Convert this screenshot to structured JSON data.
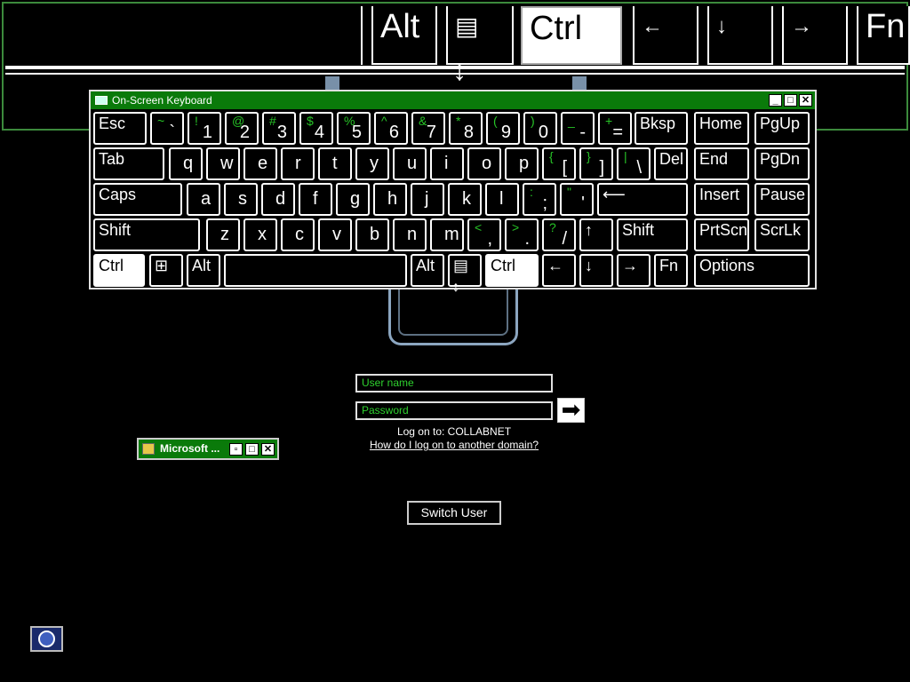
{
  "top_keys": [
    {
      "label": "Alt"
    },
    {
      "label": "▤"
    },
    {
      "label": "Ctrl"
    },
    {
      "label": "←"
    },
    {
      "label": "↓"
    },
    {
      "label": "→"
    },
    {
      "label": "Fn"
    }
  ],
  "osk": {
    "title": "On-Screen Keyboard",
    "buttons": {
      "minimize": "_",
      "maximize": "□",
      "close": "✕"
    },
    "rows": [
      [
        {
          "label": "Esc"
        },
        {
          "s": "~",
          "m": "`"
        },
        {
          "s": "!",
          "m": "1"
        },
        {
          "s": "@",
          "m": "2"
        },
        {
          "s": "#",
          "m": "3"
        },
        {
          "s": "$",
          "m": "4"
        },
        {
          "s": "%",
          "m": "5"
        },
        {
          "s": "^",
          "m": "6"
        },
        {
          "s": "&",
          "m": "7"
        },
        {
          "s": "*",
          "m": "8"
        },
        {
          "s": "(",
          "m": "9"
        },
        {
          "s": ")",
          "m": "0"
        },
        {
          "s": "_",
          "m": "-"
        },
        {
          "s": "+",
          "m": "="
        },
        {
          "label": "Bksp"
        },
        {
          "label": "Home"
        },
        {
          "label": "PgUp"
        }
      ],
      [
        {
          "label": "Tab"
        },
        {
          "label": "q"
        },
        {
          "label": "w"
        },
        {
          "label": "e"
        },
        {
          "label": "r"
        },
        {
          "label": "t"
        },
        {
          "label": "y"
        },
        {
          "label": "u"
        },
        {
          "label": "i"
        },
        {
          "label": "o"
        },
        {
          "label": "p"
        },
        {
          "s": "{",
          "m": "["
        },
        {
          "s": "}",
          "m": "]"
        },
        {
          "s": "|",
          "m": "\\"
        },
        {
          "label": "Del"
        },
        {
          "label": "End"
        },
        {
          "label": "PgDn"
        }
      ],
      [
        {
          "label": "Caps"
        },
        {
          "label": "a"
        },
        {
          "label": "s"
        },
        {
          "label": "d"
        },
        {
          "label": "f"
        },
        {
          "label": "g"
        },
        {
          "label": "h"
        },
        {
          "label": "j"
        },
        {
          "label": "k"
        },
        {
          "label": "l"
        },
        {
          "s": ":",
          "m": ";"
        },
        {
          "s": "\"",
          "m": "'"
        },
        {
          "label": "⟵"
        },
        {
          "label": "Insert"
        },
        {
          "label": "Pause"
        }
      ],
      [
        {
          "label": "Shift"
        },
        {
          "label": "z"
        },
        {
          "label": "x"
        },
        {
          "label": "c"
        },
        {
          "label": "v"
        },
        {
          "label": "b"
        },
        {
          "label": "n"
        },
        {
          "label": "m"
        },
        {
          "s": "<",
          "m": ","
        },
        {
          "s": ">",
          "m": "."
        },
        {
          "s": "?",
          "m": "/"
        },
        {
          "label": "↑"
        },
        {
          "label": "Shift"
        },
        {
          "label": "PrtScn"
        },
        {
          "label": "ScrLk"
        }
      ],
      [
        {
          "label": "Ctrl"
        },
        {
          "label": "⊞"
        },
        {
          "label": "Alt"
        },
        {
          "label": ""
        },
        {
          "label": "Alt"
        },
        {
          "label": "▤"
        },
        {
          "label": "Ctrl"
        },
        {
          "label": "←"
        },
        {
          "label": "↓"
        },
        {
          "label": "→"
        },
        {
          "label": "Fn"
        },
        {
          "label": "Options"
        }
      ]
    ]
  },
  "login": {
    "username_placeholder": "User name",
    "password_placeholder": "Password",
    "submit_icon": "arrow-right-icon",
    "log_on_to": "Log on to: COLLABNET",
    "domain_link": "How do I log on to another domain?",
    "switch_user": "Switch User"
  },
  "mini_window": {
    "title": "Microsoft ...",
    "buttons": {
      "restore": "▫",
      "maximize": "□",
      "close": "✕"
    }
  },
  "colors": {
    "title_green": "#0a7a0a",
    "shift_green": "#27c427",
    "field_text": "#2ed12e"
  }
}
